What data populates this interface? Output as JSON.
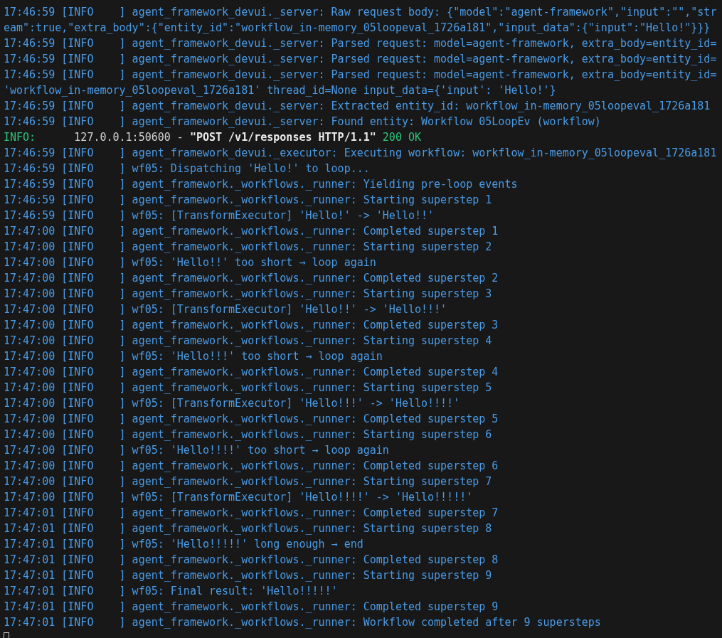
{
  "terminal": {
    "lines": [
      {
        "kind": "log",
        "text": "17:46:59 [INFO    ] agent_framework_devui._server: Raw request body: {\"model\":\"agent-framework\",\"input\":\"\",\"str"
      },
      {
        "kind": "log",
        "text": "eam\":true,\"extra_body\":{\"entity_id\":\"workflow_in-memory_05loopeval_1726a181\",\"input_data\":{\"input\":\"Hello!\"}}}"
      },
      {
        "kind": "log",
        "text": "17:46:59 [INFO    ] agent_framework_devui._server: Parsed request: model=agent-framework, extra_body=entity_id="
      },
      {
        "kind": "log",
        "text": "17:46:59 [INFO    ] agent_framework_devui._server: Parsed request: model=agent-framework, extra_body=entity_id="
      },
      {
        "kind": "log",
        "text": "17:46:59 [INFO    ] agent_framework_devui._server: Parsed request: model=agent-framework, extra_body=entity_id="
      },
      {
        "kind": "log",
        "text": "'workflow_in-memory_05loopeval_1726a181' thread_id=None input_data={'input': 'Hello!'}"
      },
      {
        "kind": "log",
        "text": "17:46:59 [INFO    ] agent_framework_devui._server: Extracted entity_id: workflow_in-memory_05loopeval_1726a181"
      },
      {
        "kind": "log",
        "text": "17:46:59 [INFO    ] agent_framework_devui._server: Found entity: Workflow 05LoopEv (workflow)"
      },
      {
        "kind": "access",
        "level": "INFO:",
        "client": "127.0.0.1:50600 -",
        "request": "\"POST /v1/responses HTTP/1.1\"",
        "status": "200 OK"
      },
      {
        "kind": "log",
        "text": "17:46:59 [INFO    ] agent_framework_devui._executor: Executing workflow: workflow_in-memory_05loopeval_1726a181"
      },
      {
        "kind": "log",
        "text": "17:46:59 [INFO    ] wf05: Dispatching 'Hello!' to loop..."
      },
      {
        "kind": "log",
        "text": "17:46:59 [INFO    ] agent_framework._workflows._runner: Yielding pre-loop events"
      },
      {
        "kind": "log",
        "text": "17:46:59 [INFO    ] agent_framework._workflows._runner: Starting superstep 1"
      },
      {
        "kind": "log",
        "text": "17:46:59 [INFO    ] wf05: [TransformExecutor] 'Hello!' -> 'Hello!!'"
      },
      {
        "kind": "log",
        "text": "17:47:00 [INFO    ] agent_framework._workflows._runner: Completed superstep 1"
      },
      {
        "kind": "log",
        "text": "17:47:00 [INFO    ] agent_framework._workflows._runner: Starting superstep 2"
      },
      {
        "kind": "log",
        "text": "17:47:00 [INFO    ] wf05: 'Hello!!' too short → loop again"
      },
      {
        "kind": "log",
        "text": "17:47:00 [INFO    ] agent_framework._workflows._runner: Completed superstep 2"
      },
      {
        "kind": "log",
        "text": "17:47:00 [INFO    ] agent_framework._workflows._runner: Starting superstep 3"
      },
      {
        "kind": "log",
        "text": "17:47:00 [INFO    ] wf05: [TransformExecutor] 'Hello!!' -> 'Hello!!!'"
      },
      {
        "kind": "log",
        "text": "17:47:00 [INFO    ] agent_framework._workflows._runner: Completed superstep 3"
      },
      {
        "kind": "log",
        "text": "17:47:00 [INFO    ] agent_framework._workflows._runner: Starting superstep 4"
      },
      {
        "kind": "log",
        "text": "17:47:00 [INFO    ] wf05: 'Hello!!!' too short → loop again"
      },
      {
        "kind": "log",
        "text": "17:47:00 [INFO    ] agent_framework._workflows._runner: Completed superstep 4"
      },
      {
        "kind": "log",
        "text": "17:47:00 [INFO    ] agent_framework._workflows._runner: Starting superstep 5"
      },
      {
        "kind": "log",
        "text": "17:47:00 [INFO    ] wf05: [TransformExecutor] 'Hello!!!' -> 'Hello!!!!'"
      },
      {
        "kind": "log",
        "text": "17:47:00 [INFO    ] agent_framework._workflows._runner: Completed superstep 5"
      },
      {
        "kind": "log",
        "text": "17:47:00 [INFO    ] agent_framework._workflows._runner: Starting superstep 6"
      },
      {
        "kind": "log",
        "text": "17:47:00 [INFO    ] wf05: 'Hello!!!!' too short → loop again"
      },
      {
        "kind": "log",
        "text": "17:47:00 [INFO    ] agent_framework._workflows._runner: Completed superstep 6"
      },
      {
        "kind": "log",
        "text": "17:47:00 [INFO    ] agent_framework._workflows._runner: Starting superstep 7"
      },
      {
        "kind": "log",
        "text": "17:47:00 [INFO    ] wf05: [TransformExecutor] 'Hello!!!!' -> 'Hello!!!!!'"
      },
      {
        "kind": "log",
        "text": "17:47:01 [INFO    ] agent_framework._workflows._runner: Completed superstep 7"
      },
      {
        "kind": "log",
        "text": "17:47:01 [INFO    ] agent_framework._workflows._runner: Starting superstep 8"
      },
      {
        "kind": "log",
        "text": "17:47:01 [INFO    ] wf05: 'Hello!!!!!' long enough → end"
      },
      {
        "kind": "log",
        "text": "17:47:01 [INFO    ] agent_framework._workflows._runner: Completed superstep 8"
      },
      {
        "kind": "log",
        "text": "17:47:01 [INFO    ] agent_framework._workflows._runner: Starting superstep 9"
      },
      {
        "kind": "log",
        "text": "17:47:01 [INFO    ] wf05: Final result: 'Hello!!!!!'"
      },
      {
        "kind": "log",
        "text": "17:47:01 [INFO    ] agent_framework._workflows._runner: Completed superstep 9"
      },
      {
        "kind": "log",
        "text": "17:47:01 [INFO    ] agent_framework._workflows._runner: Workflow completed after 9 supersteps"
      }
    ]
  }
}
